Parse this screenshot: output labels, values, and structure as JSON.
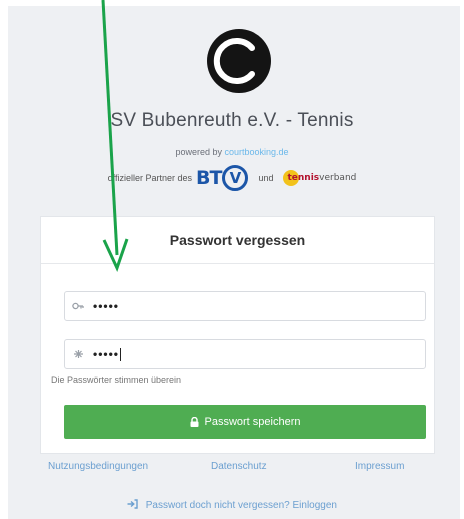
{
  "header": {
    "club_title": "SV Bubenreuth e.V. - Tennis",
    "powered_prefix": "powered by ",
    "powered_link": "courtbooking.de",
    "partner_text": "offizieller Partner des",
    "and_text": "und",
    "btv_logo_text": "BT",
    "btv_logo_v": "V",
    "tv_logo_text_bold": "tennis",
    "tv_logo_text_rest": "verband"
  },
  "card": {
    "title": "Passwort vergessen",
    "password_value": "•••••",
    "confirm_value": "•••••",
    "match_message": "Die Passwörter stimmen überein",
    "save_label": "Passwort speichern"
  },
  "footer": {
    "terms_label": "Nutzungsbedingungen",
    "privacy_label": "Datenschutz",
    "imprint_label": "Impressum",
    "login_label": "Passwort doch nicht vergessen? Einloggen"
  },
  "colors": {
    "accent_green": "#4fad52",
    "link_blue": "#6b9fd0",
    "annotation_arrow": "#1aa34a"
  },
  "icons": {
    "logo": "tennis-ball-logo",
    "password_field": "key-icon",
    "confirm_field": "asterisk-icon",
    "save_button": "lock-icon",
    "login_link": "sign-in-icon"
  }
}
